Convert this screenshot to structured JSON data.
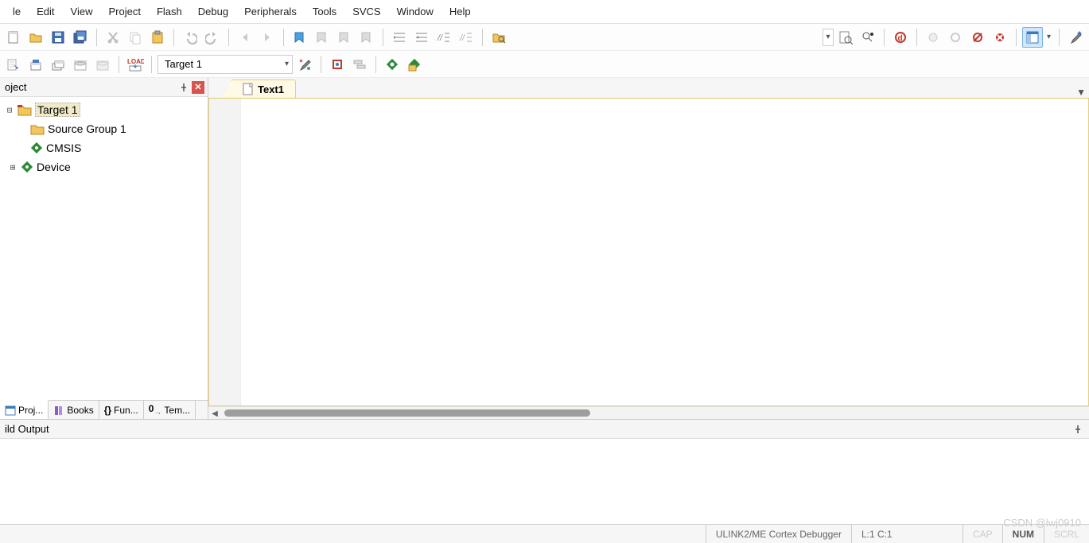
{
  "menu": {
    "items": [
      "le",
      "Edit",
      "View",
      "Project",
      "Flash",
      "Debug",
      "Peripherals",
      "Tools",
      "SVCS",
      "Window",
      "Help"
    ]
  },
  "toolbar1": {
    "target_dropdown_collapsed": ""
  },
  "toolbar2": {
    "load_label": "LOAD",
    "target_selected": "Target 1"
  },
  "project_pane": {
    "title": "oject",
    "tree": {
      "root": "Target 1",
      "items": [
        {
          "label": "Source Group 1",
          "icon": "folder"
        },
        {
          "label": "CMSIS",
          "icon": "diamond"
        },
        {
          "label": "Device",
          "icon": "diamond",
          "expandable": true
        }
      ]
    },
    "bottom_tabs": [
      "Proj...",
      "Books",
      "Fun...",
      "Tem..."
    ]
  },
  "editor": {
    "tabs": [
      "Text1"
    ]
  },
  "build_output": {
    "title": "ild Output"
  },
  "statusbar": {
    "debugger": "ULINK2/ME Cortex Debugger",
    "pos": "L:1 C:1",
    "caps": "CAP",
    "num": "NUM",
    "scrl": "SCRL"
  },
  "watermark": "CSDN @lwj0910"
}
